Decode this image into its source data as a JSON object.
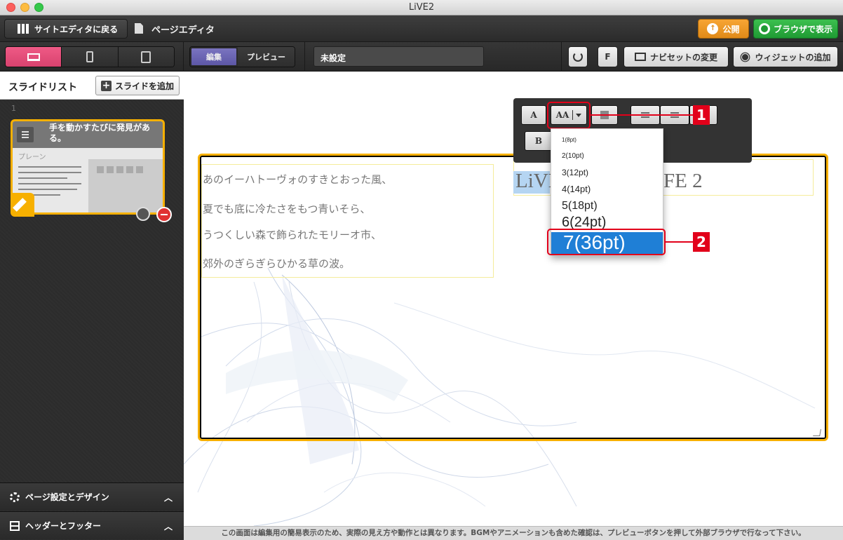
{
  "window": {
    "title": "LiVE2"
  },
  "topbar": {
    "back_label": "サイトエディタに戻る",
    "page_title": "ページエディタ",
    "publish_label": "公開",
    "browser_label": "ブラウザで表示"
  },
  "toolbar": {
    "devices": [
      "desktop",
      "phone",
      "tablet"
    ],
    "active_device": "desktop",
    "mode_edit": "編集",
    "mode_preview": "プレビュー",
    "page_name": "未設定",
    "f_label": "F",
    "navset_label": "ナビセットの変更",
    "widget_label": "ウィジェットの追加"
  },
  "sidebar": {
    "title": "スライドリスト",
    "add_slide_label": "スライドを追加",
    "slides": [
      {
        "number": "1",
        "title": "手を動かすたびに発見がある。",
        "layout": "プレーン"
      }
    ],
    "panels": [
      {
        "label": "ページ設定とデザイン",
        "icon": "gear-icon"
      },
      {
        "label": "ヘッダーとフッター",
        "icon": "header-footer-icon"
      }
    ]
  },
  "canvas": {
    "text_lines": [
      "あのイーハトーヴォのすきとおった風、",
      "夏でも底に冷たさをもつ青いそら、",
      "うつくしい森で飾られたモリーオ市、",
      "郊外のぎらぎらひかる草の波。"
    ],
    "title_visible_left": "LiVE",
    "title_visible_right": "FE 2"
  },
  "format_toolbar": {
    "font_button": "A",
    "fontsize_button": "AA",
    "bold_button": "B"
  },
  "fontsize_menu": {
    "items": [
      "1(8pt)",
      "2(10pt)",
      "3(12pt)",
      "4(14pt)",
      "5(18pt)",
      "6(24pt)",
      "7(36pt)"
    ],
    "selected": "7(36pt)"
  },
  "callouts": [
    "1",
    "2"
  ],
  "colors": {
    "accent_yellow": "#f7b000",
    "device_active": "#e54b7a",
    "publish_orange": "#f0961f",
    "browser_green": "#2fae42",
    "selection_blue": "#1f7fd6",
    "callout_red": "#e2001a"
  },
  "footer_notice": "この画面は編集用の簡易表示のため、実際の見え方や動作とは異なります。BGMやアニメーションも含めた確認は、プレビューボタンを押して外部ブラウザで行なって下さい。"
}
